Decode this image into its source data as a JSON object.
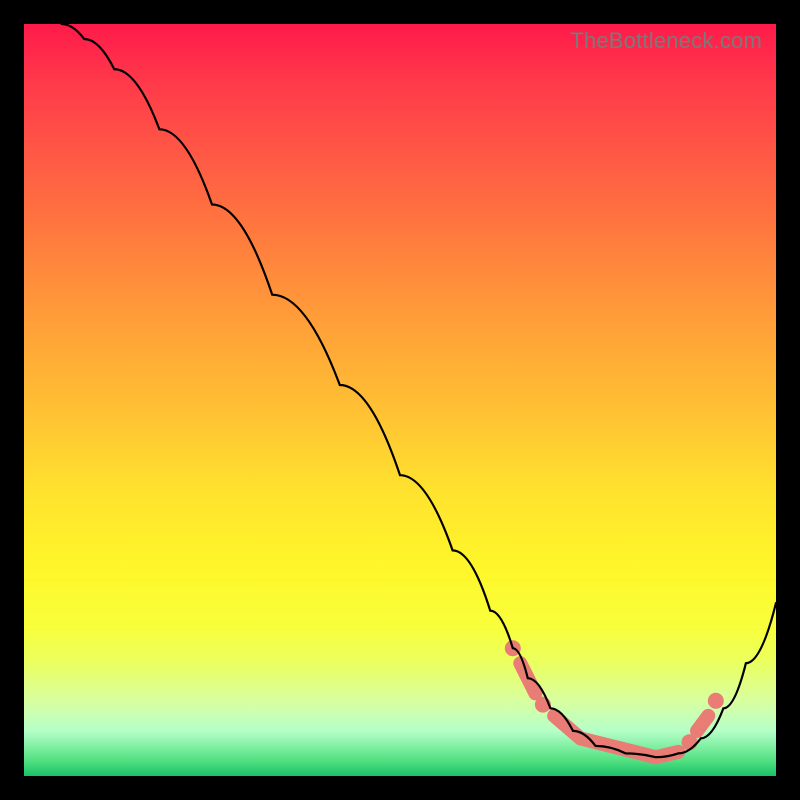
{
  "watermark": "TheBottleneck.com",
  "colors": {
    "bead": "#e97c74",
    "curve": "#000000",
    "background": "#000000"
  },
  "chart_data": {
    "type": "line",
    "title": "",
    "xlabel": "",
    "ylabel": "",
    "xlim": [
      0,
      100
    ],
    "ylim": [
      0,
      100
    ],
    "grid": false,
    "legend": false,
    "series": [
      {
        "name": "curve",
        "x": [
          5,
          8,
          12,
          18,
          25,
          33,
          42,
          50,
          57,
          62,
          65,
          67,
          70,
          73,
          76,
          80,
          84,
          87,
          90,
          93,
          96,
          100
        ],
        "y": [
          100,
          98,
          94,
          86,
          76,
          64,
          52,
          40,
          30,
          22,
          17,
          13,
          9,
          6,
          4,
          3,
          2.5,
          3,
          5,
          9,
          15,
          23
        ]
      }
    ],
    "markers": [
      {
        "type": "dot",
        "x": 65,
        "y": 17
      },
      {
        "type": "segment",
        "x0": 66,
        "y0": 15,
        "x1": 68,
        "y1": 11
      },
      {
        "type": "dot",
        "x": 69,
        "y": 9.5
      },
      {
        "type": "segment",
        "x0": 70.5,
        "y0": 8,
        "x1": 74,
        "y1": 5
      },
      {
        "type": "segment",
        "x0": 74,
        "y0": 5,
        "x1": 84,
        "y1": 2.5
      },
      {
        "type": "segment",
        "x0": 84,
        "y0": 2.5,
        "x1": 87,
        "y1": 3.2
      },
      {
        "type": "dot",
        "x": 88.5,
        "y": 4.5
      },
      {
        "type": "segment",
        "x0": 89.5,
        "y0": 6,
        "x1": 91,
        "y1": 8
      },
      {
        "type": "dot",
        "x": 92,
        "y": 10
      }
    ]
  }
}
